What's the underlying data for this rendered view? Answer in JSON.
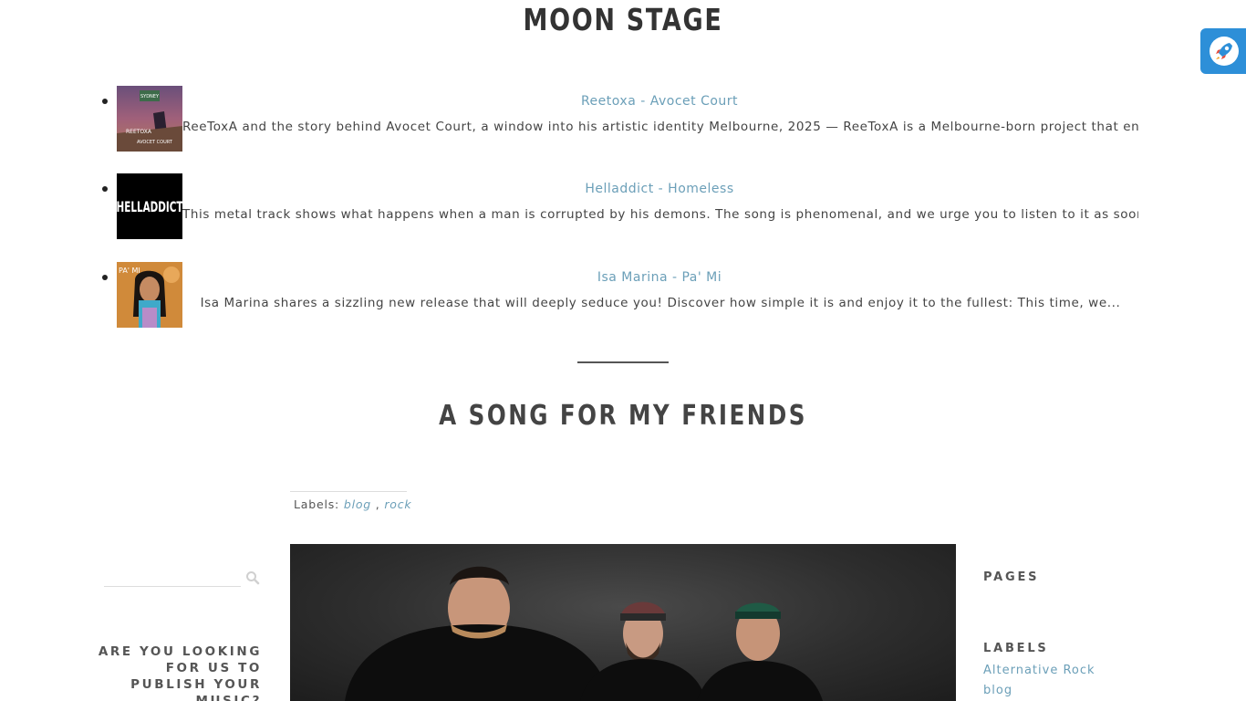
{
  "site": {
    "title": "MOON STAGE"
  },
  "posts": [
    {
      "title": "Reetoxa - Avocet Court",
      "excerpt": "ReeToxA and the story behind Avocet Court, a window into his artistic identity Melbourne, 2025 — ReeToxA is a Melbourne-born project that en...",
      "thumb_top_text": "SYDNEY",
      "thumb_text": "REETOXA",
      "thumb_subtext": "AVOCET COURT"
    },
    {
      "title": "Helladdict - Homeless",
      "excerpt": "This metal track shows what happens when a man is corrupted by his demons. The song is phenomenal, and we urge you to listen to it as soon a...",
      "thumb_text": "HELLADDICT"
    },
    {
      "title": "Isa Marina - Pa' Mi",
      "excerpt": "Isa Marina shares a sizzling new release that will deeply seduce you! Discover how simple it is and enjoy it to the fullest: This time, we...",
      "thumb_text": "PA' MI"
    }
  ],
  "article": {
    "title": "A SONG FOR MY FRIENDS",
    "labels_prefix": "Labels: ",
    "labels": [
      "blog",
      "rock"
    ],
    "labels_separator": " , "
  },
  "left_sidebar": {
    "search_placeholder": "",
    "publish_heading": "ARE YOU LOOKING FOR US TO PUBLISH YOUR MUSIC?"
  },
  "right_sidebar": {
    "pages_heading": "PAGES",
    "labels_heading": "LABELS",
    "labels": [
      "Alternative Rock",
      "blog"
    ]
  },
  "colors": {
    "link": "#6b9fb8",
    "heading": "#444444",
    "rocket_button": "#2d8fd8"
  },
  "icons": {
    "rocket": "rocket-icon",
    "search": "search-icon"
  }
}
